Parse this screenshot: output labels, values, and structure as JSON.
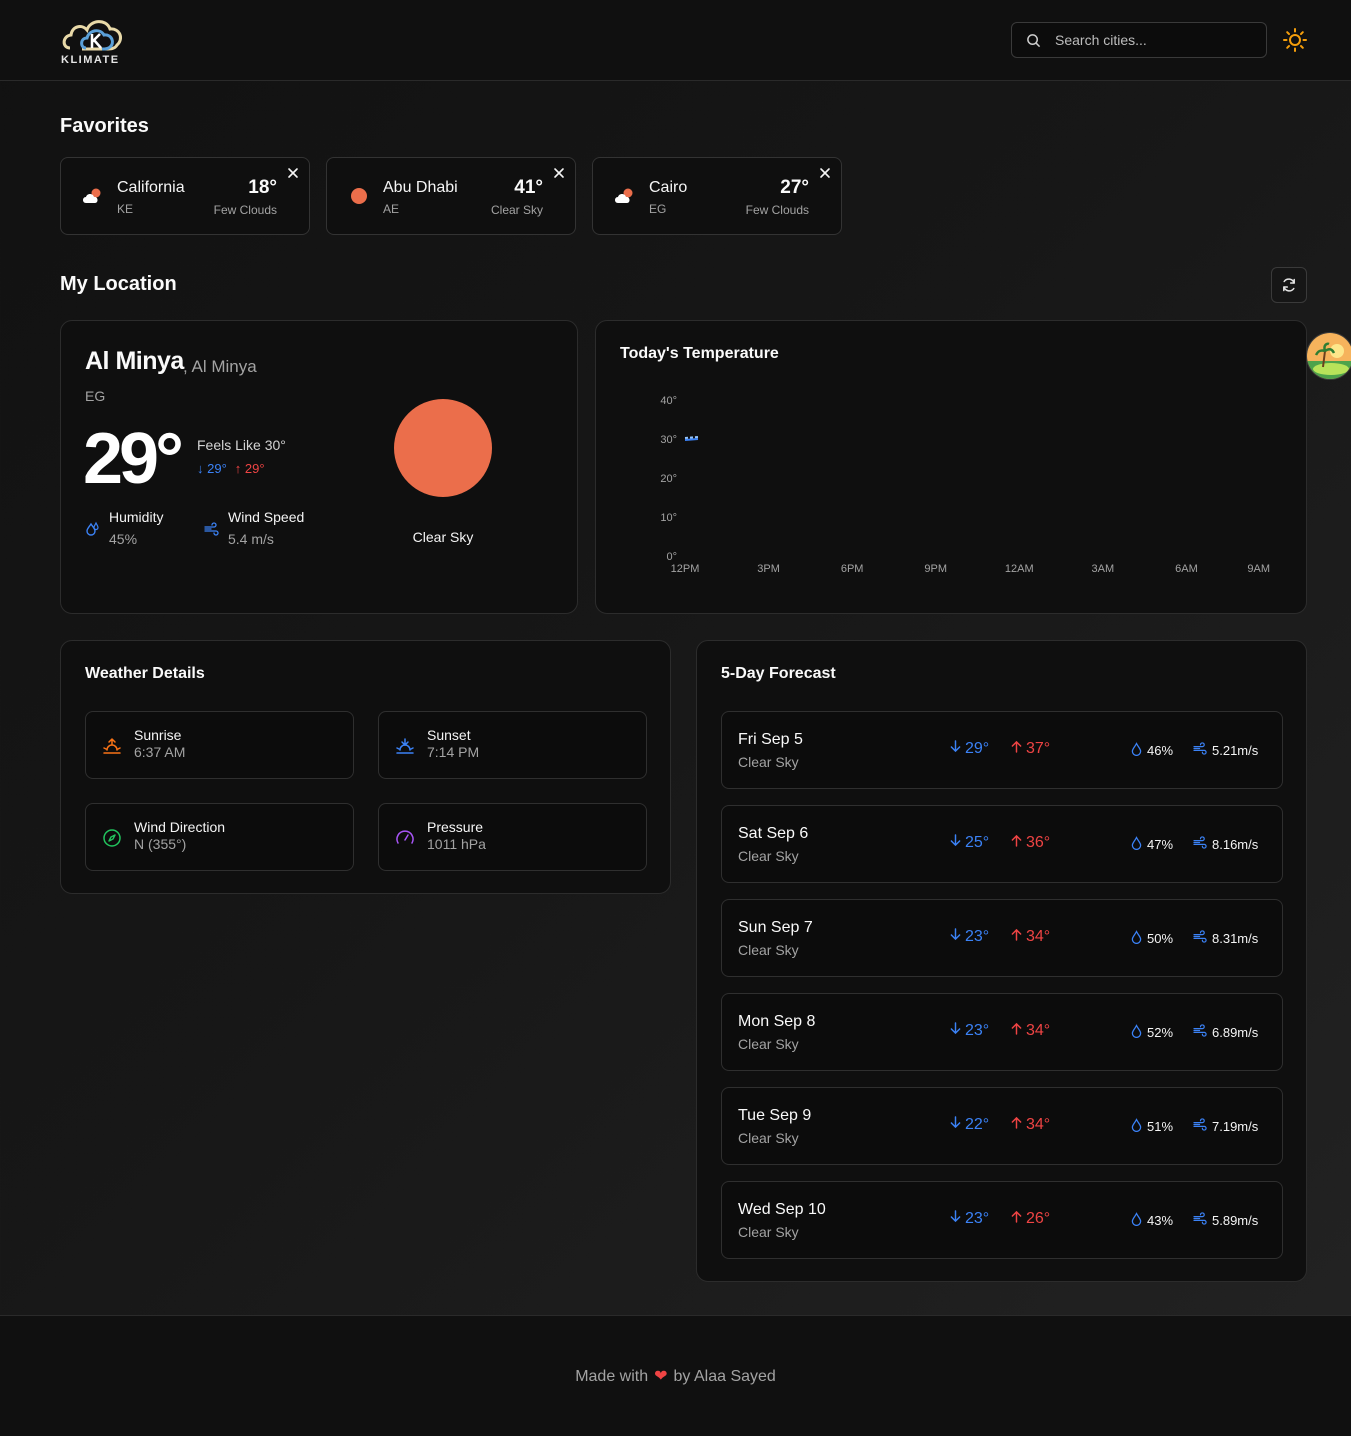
{
  "header": {
    "logo_text": "KLIMATE",
    "search_placeholder": "Search cities..."
  },
  "favorites": {
    "title": "Favorites",
    "items": [
      {
        "name": "California",
        "country": "KE",
        "temp": "18°",
        "desc": "Few Clouds",
        "icon": "few-clouds-icon"
      },
      {
        "name": "Abu Dhabi",
        "country": "AE",
        "temp": "41°",
        "desc": "Clear Sky",
        "icon": "clear-sky-icon"
      },
      {
        "name": "Cairo",
        "country": "EG",
        "temp": "27°",
        "desc": "Few Clouds",
        "icon": "few-clouds-icon"
      }
    ]
  },
  "my_location": {
    "title": "My Location",
    "city": "Al Minya",
    "region": ", Al Minya",
    "country": "EG",
    "temp": "29°",
    "feels_like": "Feels Like 30°",
    "min": "29°",
    "max": "29°",
    "humidity_label": "Humidity",
    "humidity": "45%",
    "wind_label": "Wind Speed",
    "wind": "5.4 m/s",
    "condition": "Clear Sky"
  },
  "chart_title": "Today's Temperature",
  "chart_data": {
    "type": "line",
    "title": "Today's Temperature",
    "categories": [
      "12PM",
      "3PM",
      "6PM",
      "9PM",
      "12AM",
      "3AM",
      "6AM",
      "9AM"
    ],
    "y_ticks": [
      "0°",
      "10°",
      "20°",
      "30°",
      "40°"
    ],
    "ylim": [
      0,
      40
    ],
    "series": [
      {
        "values": [
          30,
          null,
          null,
          null,
          null,
          null,
          null,
          null
        ],
        "color": "#3b82f6"
      },
      {
        "values": [
          30,
          null,
          null,
          null,
          null,
          null,
          null,
          null
        ],
        "color": "#93c5fd"
      }
    ]
  },
  "details": {
    "title": "Weather Details",
    "items": [
      {
        "label": "Sunrise",
        "value": "6:37 AM",
        "icon": "sunrise-icon",
        "color": "#f97316"
      },
      {
        "label": "Sunset",
        "value": "7:14 PM",
        "icon": "sunset-icon",
        "color": "#3b82f6"
      },
      {
        "label": "Wind Direction",
        "value": "N (355°)",
        "icon": "compass-icon",
        "color": "#22c55e"
      },
      {
        "label": "Pressure",
        "value": "1011 hPa",
        "icon": "gauge-icon",
        "color": "#a855f7"
      }
    ]
  },
  "forecast": {
    "title": "5-Day Forecast",
    "days": [
      {
        "day": "Fri Sep 5",
        "cond": "Clear Sky",
        "min": "29°",
        "max": "37°",
        "hum": "46%",
        "wind": "5.21m/s"
      },
      {
        "day": "Sat Sep 6",
        "cond": "Clear Sky",
        "min": "25°",
        "max": "36°",
        "hum": "47%",
        "wind": "8.16m/s"
      },
      {
        "day": "Sun Sep 7",
        "cond": "Clear Sky",
        "min": "23°",
        "max": "34°",
        "hum": "50%",
        "wind": "8.31m/s"
      },
      {
        "day": "Mon Sep 8",
        "cond": "Clear Sky",
        "min": "23°",
        "max": "34°",
        "hum": "52%",
        "wind": "6.89m/s"
      },
      {
        "day": "Tue Sep 9",
        "cond": "Clear Sky",
        "min": "22°",
        "max": "34°",
        "hum": "51%",
        "wind": "7.19m/s"
      },
      {
        "day": "Wed Sep 10",
        "cond": "Clear Sky",
        "min": "23°",
        "max": "26°",
        "hum": "43%",
        "wind": "5.89m/s"
      }
    ]
  },
  "footer": {
    "before": "Made with",
    "heart": "❤",
    "after": "by Alaa Sayed"
  }
}
